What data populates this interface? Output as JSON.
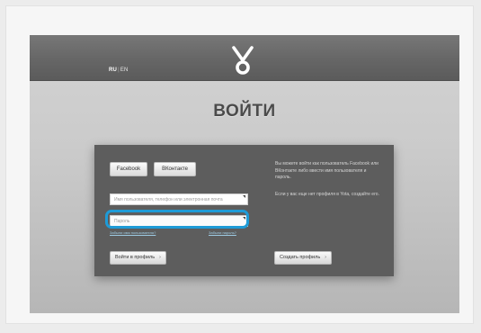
{
  "header": {
    "lang_current": "RU",
    "lang_separator": "|",
    "lang_other": "EN",
    "logo_icon": "yota-logo-icon"
  },
  "page": {
    "title": "ВОЙТИ"
  },
  "social": {
    "facebook_label": "Facebook",
    "vkontakte_label": "ВКонтакте"
  },
  "form": {
    "username_placeholder": "Имя пользователя, телефон или электронная почта",
    "username_value": "",
    "password_placeholder": "Пароль",
    "password_value": "",
    "forgot_user_link": "Забыли имя пользователя?",
    "forgot_password_link": "Забыли пароль?",
    "login_button": "Войти в профиль",
    "arrow_glyph": "›"
  },
  "info": {
    "paragraph1": "Вы можете войти как пользователь Facebook или ВКонтакте либо ввести имя пользователя и пароль.",
    "paragraph2": "Если у вас еще нет профиля в Yota, создайте его.",
    "create_button": "Создать профиль"
  },
  "colors": {
    "focus_ring": "#1e9bd7",
    "panel_bg": "#5d5d5d",
    "header_bg": "#666666"
  }
}
